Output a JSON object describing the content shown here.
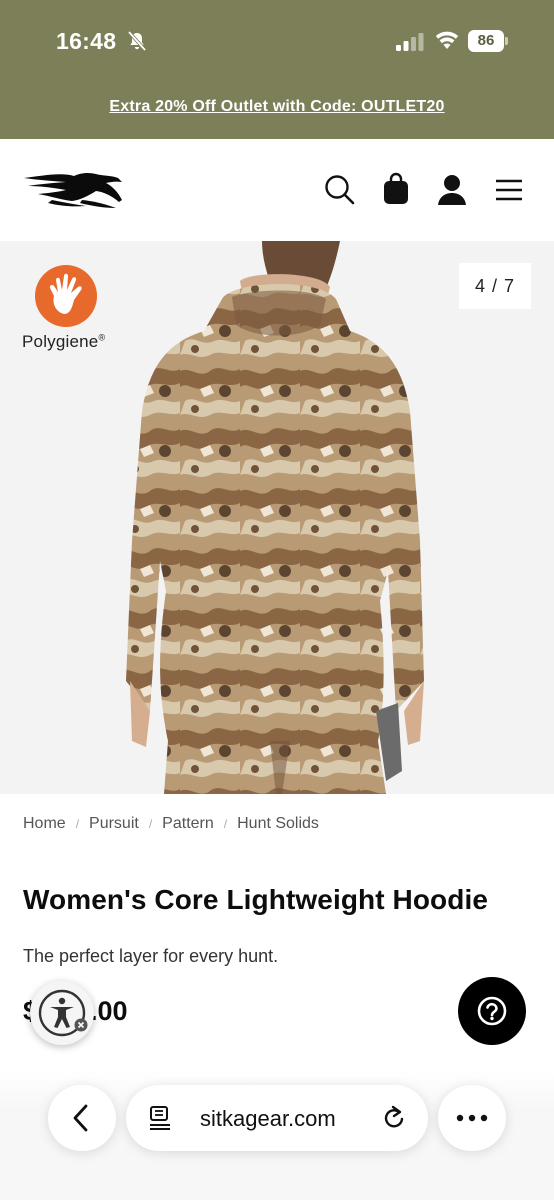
{
  "status_bar": {
    "time": "16:48",
    "battery": "86"
  },
  "promo": {
    "text": "Extra 20% Off Outlet with Code: OUTLET20"
  },
  "header": {
    "logo": "sitka-logo",
    "icons": [
      "search-icon",
      "shopping-bag-icon",
      "account-icon",
      "menu-icon"
    ]
  },
  "gallery": {
    "badge_text": "Polygiene",
    "badge_mark": "®",
    "counter": "4 / 7"
  },
  "breadcrumb": {
    "items": [
      "Home",
      "Pursuit",
      "Pattern",
      "Hunt Solids"
    ],
    "separator": "/"
  },
  "product": {
    "title": "Women's Core Lightweight Hoodie",
    "tagline": "The perfect layer for every hunt.",
    "price_visible": "$",
    "price_rest": ".00"
  },
  "browser": {
    "url": "sitkagear.com"
  },
  "colors": {
    "top_band": "#7c7f58",
    "polygiene_orange": "#e8692c",
    "help_button": "#000000"
  }
}
